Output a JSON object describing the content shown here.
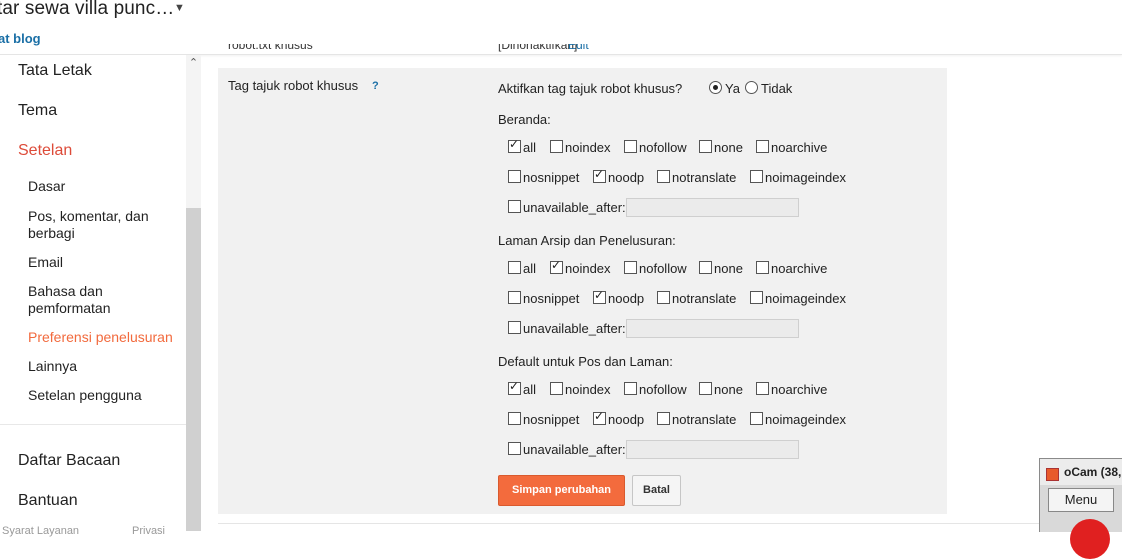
{
  "header": {
    "blog_title": "tar sewa villa punc…",
    "view_blog": "at blog"
  },
  "sidebar": {
    "main_items": [
      "Tata Letak",
      "Tema",
      "Setelan",
      "Daftar Bacaan",
      "Bantuan"
    ],
    "sub_items": [
      "Dasar",
      "Pos, komentar, dan berbagi",
      "Email",
      "Bahasa dan pemformatan",
      "Preferensi penelusuran",
      "Lainnya",
      "Setelan pengguna"
    ],
    "footer": [
      "Syarat Layanan",
      "Privasi"
    ]
  },
  "cut_row": {
    "label": "robot.txt khusus",
    "value": "[Dinonaktifkan]",
    "link": "Edit"
  },
  "setting": {
    "label": "Tag tajuk robot khusus",
    "help": "?",
    "question": "Aktifkan tag tajuk robot khusus?",
    "radio_yes": "Ya",
    "radio_no": "Tidak",
    "selected": "Ya"
  },
  "sections": [
    {
      "title": "Beranda:",
      "rows": [
        [
          {
            "label": "all",
            "checked": true
          },
          {
            "label": "noindex",
            "checked": false
          },
          {
            "label": "nofollow",
            "checked": false
          },
          {
            "label": "none",
            "checked": false
          },
          {
            "label": "noarchive",
            "checked": false
          }
        ],
        [
          {
            "label": "nosnippet",
            "checked": false
          },
          {
            "label": "noodp",
            "checked": true
          },
          {
            "label": "notranslate",
            "checked": false
          },
          {
            "label": "noimageindex",
            "checked": false
          }
        ],
        [
          {
            "label": "unavailable_after:",
            "checked": false
          }
        ]
      ]
    },
    {
      "title": "Laman Arsip dan Penelusuran:",
      "rows": [
        [
          {
            "label": "all",
            "checked": false
          },
          {
            "label": "noindex",
            "checked": true
          },
          {
            "label": "nofollow",
            "checked": false
          },
          {
            "label": "none",
            "checked": false
          },
          {
            "label": "noarchive",
            "checked": false
          }
        ],
        [
          {
            "label": "nosnippet",
            "checked": false
          },
          {
            "label": "noodp",
            "checked": true
          },
          {
            "label": "notranslate",
            "checked": false
          },
          {
            "label": "noimageindex",
            "checked": false
          }
        ],
        [
          {
            "label": "unavailable_after:",
            "checked": false
          }
        ]
      ]
    },
    {
      "title": "Default untuk Pos dan Laman:",
      "rows": [
        [
          {
            "label": "all",
            "checked": true
          },
          {
            "label": "noindex",
            "checked": false
          },
          {
            "label": "nofollow",
            "checked": false
          },
          {
            "label": "none",
            "checked": false
          },
          {
            "label": "noarchive",
            "checked": false
          }
        ],
        [
          {
            "label": "nosnippet",
            "checked": false
          },
          {
            "label": "noodp",
            "checked": true
          },
          {
            "label": "notranslate",
            "checked": false
          },
          {
            "label": "noimageindex",
            "checked": false
          }
        ],
        [
          {
            "label": "unavailable_after:",
            "checked": false
          }
        ]
      ]
    }
  ],
  "buttons": {
    "save": "Simpan perubahan",
    "cancel": "Batal"
  },
  "ocam": {
    "title": "oCam (38,",
    "menu": "Menu"
  },
  "colors": {
    "accent": "#f36b3d",
    "active_nav": "#dd4b39",
    "link": "#1a6fa6"
  }
}
